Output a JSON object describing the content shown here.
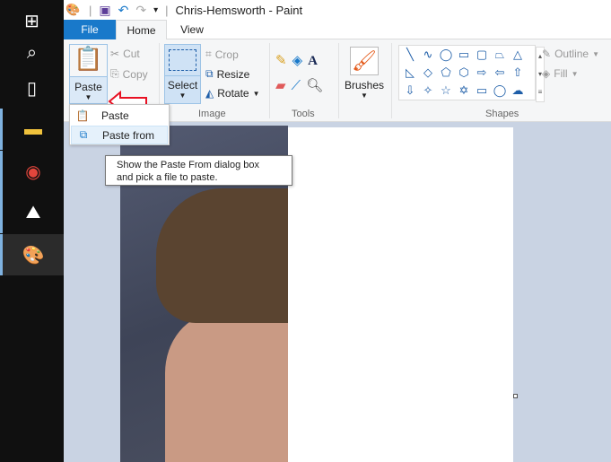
{
  "window": {
    "title": "Chris-Hemsworth - Paint"
  },
  "tabs": [
    {
      "label": "File"
    },
    {
      "label": "Home"
    },
    {
      "label": "View"
    }
  ],
  "clipboard": {
    "paste": "Paste",
    "cut": "Cut",
    "copy": "Copy"
  },
  "image": {
    "select": "Select",
    "crop": "Crop",
    "resize": "Resize",
    "rotate": "Rotate",
    "group": "Image"
  },
  "tools": {
    "group": "Tools"
  },
  "brushes": {
    "label": "Brushes"
  },
  "shapes": {
    "group": "Shapes",
    "outline": "Outline",
    "fill": "Fill",
    "items": [
      "╲",
      "∿",
      "◯",
      "▭",
      "▢",
      "⏢",
      "△",
      "◺",
      "◇",
      "⬠",
      "⬡",
      "⇨",
      "⇦",
      "⇧",
      "⇩",
      "✧",
      "☆",
      "✡",
      "▭",
      "◯",
      "☁"
    ]
  },
  "paste_menu": {
    "items": [
      {
        "label": "Paste"
      },
      {
        "label": "Paste from"
      }
    ]
  },
  "tooltip": {
    "text_line1": "Show the Paste From dialog box",
    "text_line2": "and pick a file to paste."
  },
  "colors": {
    "accent": "#1979ca",
    "arrow": "#e81123"
  }
}
